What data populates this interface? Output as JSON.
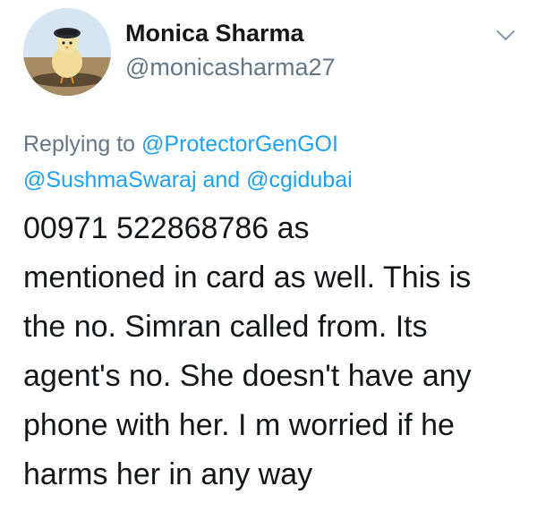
{
  "tweet": {
    "author": {
      "display_name": "Monica Sharma",
      "handle": "@monicasharma27",
      "avatar_icon": "chick-avatar"
    },
    "menu_icon": "chevron-down-icon",
    "reply": {
      "prefix": "Replying to",
      "mention_1": "@ProtectorGenGOI",
      "mention_2": "@SushmaSwaraj",
      "conjunction": "and",
      "mention_3": "@cgidubai"
    },
    "text_lines": [
      "00971 522868786 as",
      "mentioned in card as well. This is",
      "the no. Simran called from. Its",
      "agent's no. She doesn't have any",
      "phone with her. I m worried if he",
      "harms her in any way"
    ]
  },
  "colors": {
    "link": "#1da1f2",
    "secondary_text": "#657786",
    "primary_text": "#14171a",
    "background": "#ffffff"
  }
}
